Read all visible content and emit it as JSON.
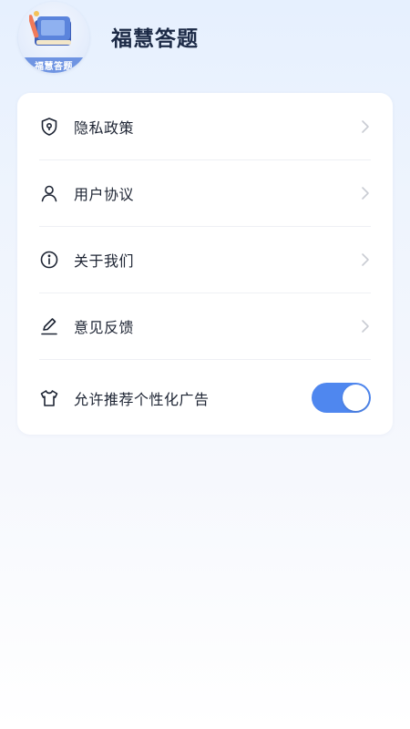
{
  "app": {
    "name": "福慧答题",
    "logo_text": "福慧答题"
  },
  "colors": {
    "accent": "#4f87ef",
    "text_primary": "#1d2433",
    "chevron": "#c9ccd3",
    "divider": "#eef0f4"
  },
  "menu": {
    "items": [
      {
        "label": "隐私政策",
        "icon": "shield-icon"
      },
      {
        "label": "用户协议",
        "icon": "user-icon"
      },
      {
        "label": "关于我们",
        "icon": "info-icon"
      },
      {
        "label": "意见反馈",
        "icon": "pencil-icon"
      },
      {
        "label": "允许推荐个性化广告",
        "icon": "shirt-icon",
        "toggle": true,
        "toggle_on": true
      }
    ]
  }
}
